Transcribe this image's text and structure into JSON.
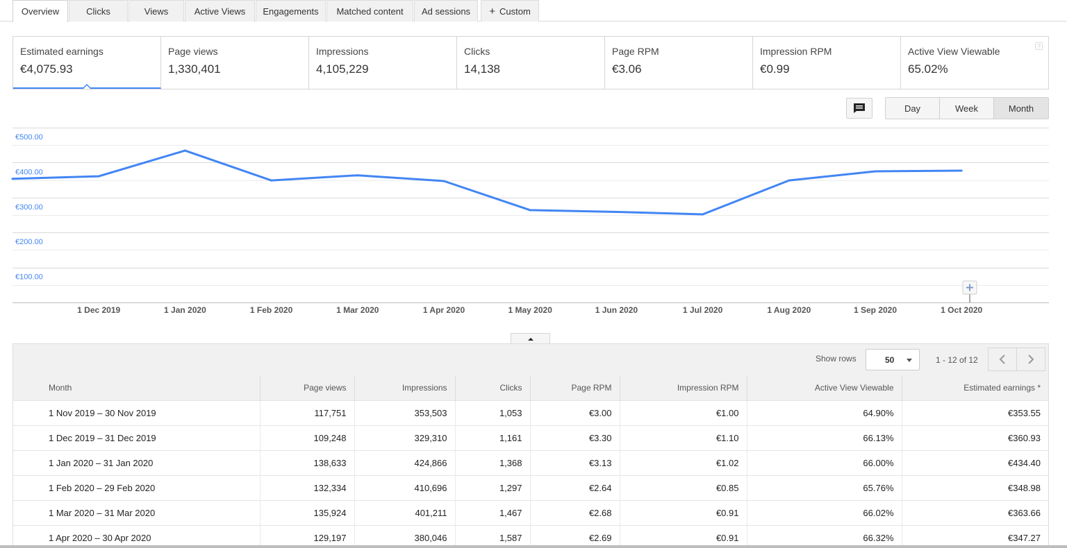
{
  "tabs": [
    {
      "label": "Overview"
    },
    {
      "label": "Clicks"
    },
    {
      "label": "Views"
    },
    {
      "label": "Active Views"
    },
    {
      "label": "Engagements"
    },
    {
      "label": "Matched content"
    },
    {
      "label": "Ad sessions"
    },
    {
      "label": "Custom"
    }
  ],
  "scorecards": [
    {
      "label": "Estimated earnings",
      "value": "€4,075.93"
    },
    {
      "label": "Page views",
      "value": "1,330,401"
    },
    {
      "label": "Impressions",
      "value": "4,105,229"
    },
    {
      "label": "Clicks",
      "value": "14,138"
    },
    {
      "label": "Page RPM",
      "value": "€3.06"
    },
    {
      "label": "Impression RPM",
      "value": "€0.99"
    },
    {
      "label": "Active View Viewable",
      "value": "65.02%"
    }
  ],
  "help_icon": "?",
  "period_buttons": {
    "day": "Day",
    "week": "Week",
    "month": "Month",
    "selected": "Month"
  },
  "chart_data": {
    "type": "line",
    "x": [
      "1 Nov 2019",
      "1 Dec 2019",
      "1 Jan 2020",
      "1 Feb 2020",
      "1 Mar 2020",
      "1 Apr 2020",
      "1 May 2020",
      "1 Jun 2020",
      "1 Jul 2020",
      "1 Aug 2020",
      "1 Sep 2020",
      "1 Oct 2020"
    ],
    "x_tick_labels": [
      "1 Dec 2019",
      "1 Jan 2020",
      "1 Feb 2020",
      "1 Mar 2020",
      "1 Apr 2020",
      "1 May 2020",
      "1 Jun 2020",
      "1 Jul 2020",
      "1 Aug 2020",
      "1 Sep 2020",
      "1 Oct 2020"
    ],
    "series": [
      {
        "values": [
          353.55,
          360.93,
          434.4,
          348.98,
          363.66,
          347.27,
          264.0,
          259.0,
          252.0,
          349.0,
          375.0,
          377.0
        ],
        "color": "#4285f4"
      }
    ],
    "y_tick_labels": [
      "€500.00",
      "€400.00",
      "€300.00",
      "€200.00",
      "€100.00"
    ],
    "y_ticks": [
      500,
      400,
      300,
      200,
      100
    ],
    "ylim": [
      0,
      500
    ],
    "grid": true
  },
  "table_controls": {
    "show_rows_label": "Show rows",
    "rows_value": "50",
    "range_text": "1 - 12 of 12"
  },
  "table": {
    "columns": [
      "Month",
      "Page views",
      "Impressions",
      "Clicks",
      "Page RPM",
      "Impression RPM",
      "Active View Viewable",
      "Estimated earnings *"
    ],
    "rows": [
      [
        "1 Nov 2019 – 30 Nov 2019",
        "117,751",
        "353,503",
        "1,053",
        "€3.00",
        "€1.00",
        "64.90%",
        "€353.55"
      ],
      [
        "1 Dec 2019 – 31 Dec 2019",
        "109,248",
        "329,310",
        "1,161",
        "€3.30",
        "€1.10",
        "66.13%",
        "€360.93"
      ],
      [
        "1 Jan 2020 – 31 Jan 2020",
        "138,633",
        "424,866",
        "1,368",
        "€3.13",
        "€1.02",
        "66.00%",
        "€434.40"
      ],
      [
        "1 Feb 2020 – 29 Feb 2020",
        "132,334",
        "410,696",
        "1,297",
        "€2.64",
        "€0.85",
        "65.76%",
        "€348.98"
      ],
      [
        "1 Mar 2020 – 31 Mar 2020",
        "135,924",
        "401,211",
        "1,467",
        "€2.68",
        "€0.91",
        "66.02%",
        "€363.66"
      ],
      [
        "1 Apr 2020 – 30 Apr 2020",
        "129,197",
        "380,046",
        "1,587",
        "€2.69",
        "€0.91",
        "66.32%",
        "€347.27"
      ]
    ]
  },
  "colors": {
    "accent": "#4285f4"
  }
}
